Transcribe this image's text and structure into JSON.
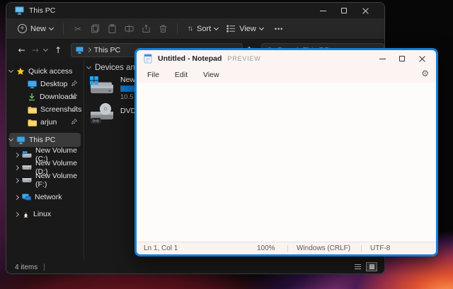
{
  "icons": {
    "plus": "+",
    "back_arrow": "←",
    "forward_arrow": "→",
    "up_arrow": "↑",
    "refresh": "↻",
    "sort_arrows": "↑↓",
    "more_dots": "•••",
    "gear": "⚙",
    "cut": "✂"
  },
  "explorer": {
    "window_title": "This PC",
    "toolbar": {
      "new_label": "New",
      "sort_label": "Sort",
      "view_label": "View"
    },
    "navigation": {
      "breadcrumb_root": "This PC",
      "search_placeholder": "Search This PC"
    },
    "sidebar": {
      "quick_access_label": "Quick access",
      "quick_access_items": [
        {
          "label": "Desktop"
        },
        {
          "label": "Downloads"
        },
        {
          "label": "Screenshots"
        },
        {
          "label": "arjun"
        }
      ],
      "this_pc_label": "This PC",
      "drive_items": [
        {
          "label": "New Volume (C:)"
        },
        {
          "label": "New Volume (D:)"
        },
        {
          "label": "New Volume (F:)"
        }
      ],
      "network_label": "Network",
      "linux_label": "Linux"
    },
    "content": {
      "section_label": "Devices and drives",
      "drives": [
        {
          "name": "New Volu",
          "free_space": "10.5 GB f",
          "usage_percent": 100
        },
        {
          "name": "DVD RW",
          "badge": "DVD"
        }
      ]
    },
    "statusbar": {
      "item_count": "4 items"
    }
  },
  "notepad": {
    "window_title": "Untitled - Notepad",
    "preview_badge": "PREVIEW",
    "menus": [
      {
        "label": "File"
      },
      {
        "label": "Edit"
      },
      {
        "label": "View"
      }
    ],
    "editor_content": "",
    "statusbar": {
      "cursor_position": "Ln 1, Col 1",
      "zoom_level": "100%",
      "line_ending": "Windows (CRLF)",
      "encoding": "UTF-8"
    }
  },
  "colors": {
    "accent": "#0f80da",
    "usage_bar": "#0078d4"
  }
}
